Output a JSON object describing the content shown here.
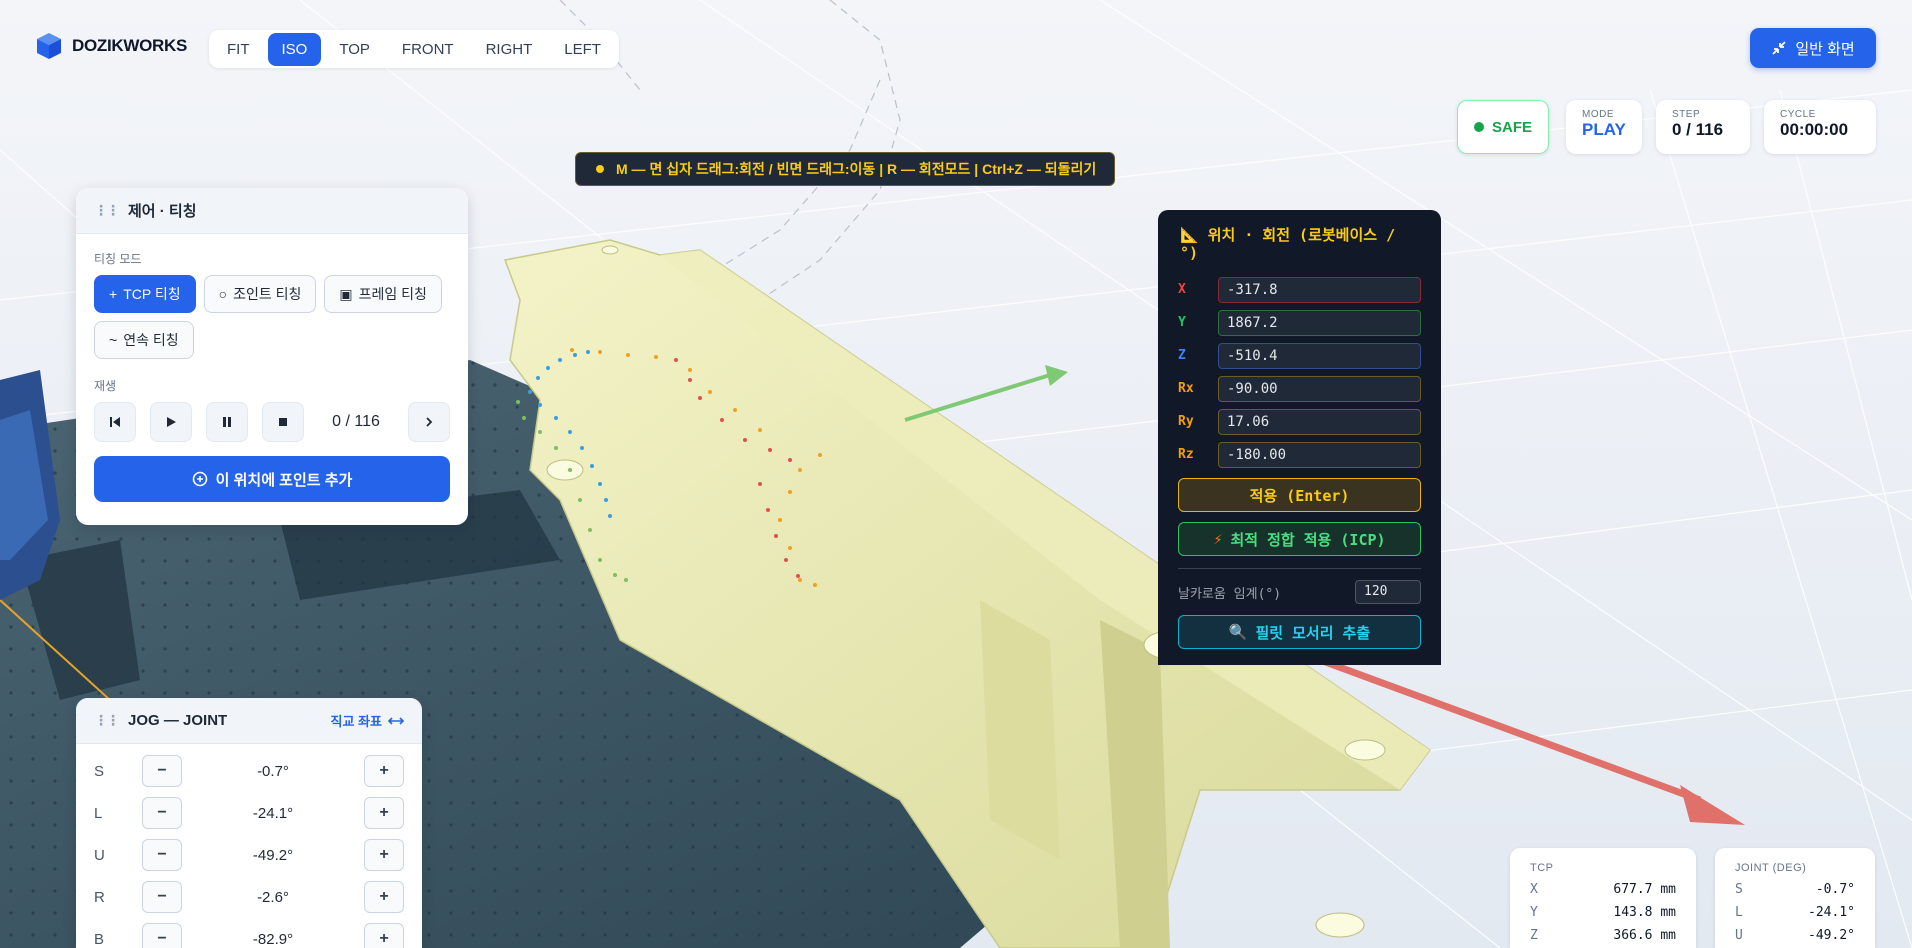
{
  "app": {
    "name": "DOZIKWORKS"
  },
  "view_buttons": [
    {
      "label": "FIT",
      "active": false
    },
    {
      "label": "ISO",
      "active": true
    },
    {
      "label": "TOP",
      "active": false
    },
    {
      "label": "FRONT",
      "active": false
    },
    {
      "label": "RIGHT",
      "active": false
    },
    {
      "label": "LEFT",
      "active": false
    }
  ],
  "header": {
    "normal_view_label": "일반 화면"
  },
  "status": {
    "safe_label": "SAFE",
    "mode": {
      "label": "MODE",
      "value": "PLAY"
    },
    "step": {
      "label": "STEP",
      "value": "0 / 116"
    },
    "cycle": {
      "label": "CYCLE",
      "value": "00:00:00"
    }
  },
  "hint": "M — 면 십자 드래그:회전 / 빈면 드래그:이동 | R — 회전모드 | Ctrl+Z — 되돌리기",
  "teach_panel": {
    "title": "제어 · 티칭",
    "mode_label": "티칭 모드",
    "modes": [
      {
        "label": "TCP 티칭",
        "icon": "+",
        "active": true
      },
      {
        "label": "조인트 티칭",
        "icon": "○",
        "active": false
      },
      {
        "label": "프레임 티칭",
        "icon": "▣",
        "active": false
      },
      {
        "label": "연속 티칭",
        "icon": "~",
        "active": false
      }
    ],
    "playback_label": "재생",
    "step_counter": "0 / 116",
    "add_point_label": "이 위치에 포인트 추가"
  },
  "pose_panel": {
    "title": "위치 · 회전 (로봇베이스 / °)",
    "fields": [
      {
        "key": "X",
        "value": "-317.8",
        "color": "#ef4444"
      },
      {
        "key": "Y",
        "value": "1867.2",
        "color": "#22c55e"
      },
      {
        "key": "Z",
        "value": "-510.4",
        "color": "#3b82f6"
      },
      {
        "key": "Rx",
        "value": "-90.00",
        "color": "#f59e0b"
      },
      {
        "key": "Ry",
        "value": "17.06",
        "color": "#f59e0b"
      },
      {
        "key": "Rz",
        "value": "-180.00",
        "color": "#f59e0b"
      }
    ],
    "apply_label": "적용 (Enter)",
    "icp_label": "최적 정합 적용 (ICP)",
    "sharpness_label": "날카로움 임계(°)",
    "sharpness_value": "120",
    "extract_label": "필릿 모서리 추출"
  },
  "jog_panel": {
    "title": "JOG — JOINT",
    "switch_label": "직교 좌표",
    "joints": [
      {
        "axis": "S",
        "value": "-0.7°"
      },
      {
        "axis": "L",
        "value": "-24.1°"
      },
      {
        "axis": "U",
        "value": "-49.2°"
      },
      {
        "axis": "R",
        "value": "-2.6°"
      },
      {
        "axis": "B",
        "value": "-82.9°"
      }
    ]
  },
  "tcp_card": {
    "label": "TCP",
    "rows": [
      {
        "k": "X",
        "v": "677.7 mm"
      },
      {
        "k": "Y",
        "v": "143.8 mm"
      },
      {
        "k": "Z",
        "v": "366.6 mm"
      }
    ]
  },
  "joint_card": {
    "label": "JOINT (DEG)",
    "rows": [
      {
        "k": "S",
        "v": "-0.7°"
      },
      {
        "k": "L",
        "v": "-24.1°"
      },
      {
        "k": "U",
        "v": "-49.2°"
      }
    ]
  }
}
